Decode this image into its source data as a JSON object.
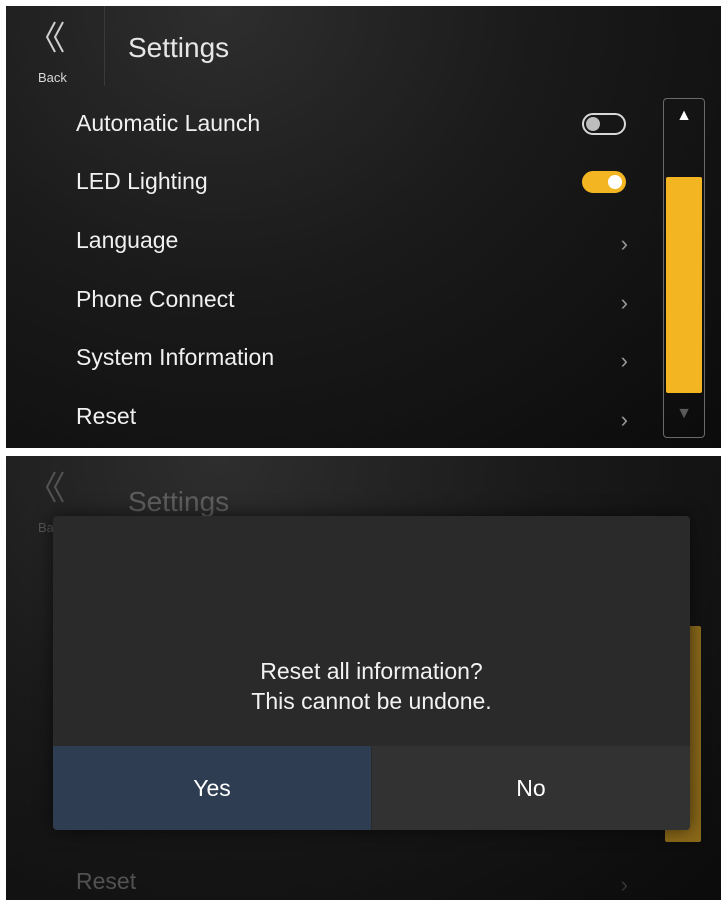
{
  "settings": {
    "back_label": "Back",
    "title": "Settings",
    "items": [
      {
        "label": "Automatic Launch",
        "control": "toggle",
        "state": "off"
      },
      {
        "label": "LED Lighting",
        "control": "toggle",
        "state": "on"
      },
      {
        "label": "Language",
        "control": "chevron"
      },
      {
        "label": "Phone Connect",
        "control": "chevron"
      },
      {
        "label": "System Information",
        "control": "chevron"
      },
      {
        "label": "Reset",
        "control": "chevron"
      }
    ],
    "chevron_glyph": "›",
    "scroll_up_glyph": "▲",
    "scroll_down_glyph": "▼"
  },
  "dialog": {
    "message_line1": "Reset all information?",
    "message_line2": "This cannot be undone.",
    "yes_label": "Yes",
    "no_label": "No"
  },
  "colors": {
    "accent": "#f3b522",
    "background": "#111111",
    "yes_button": "#2f3d52",
    "no_button": "#323232"
  },
  "icons": {
    "back": "double-chevron-left-icon"
  }
}
